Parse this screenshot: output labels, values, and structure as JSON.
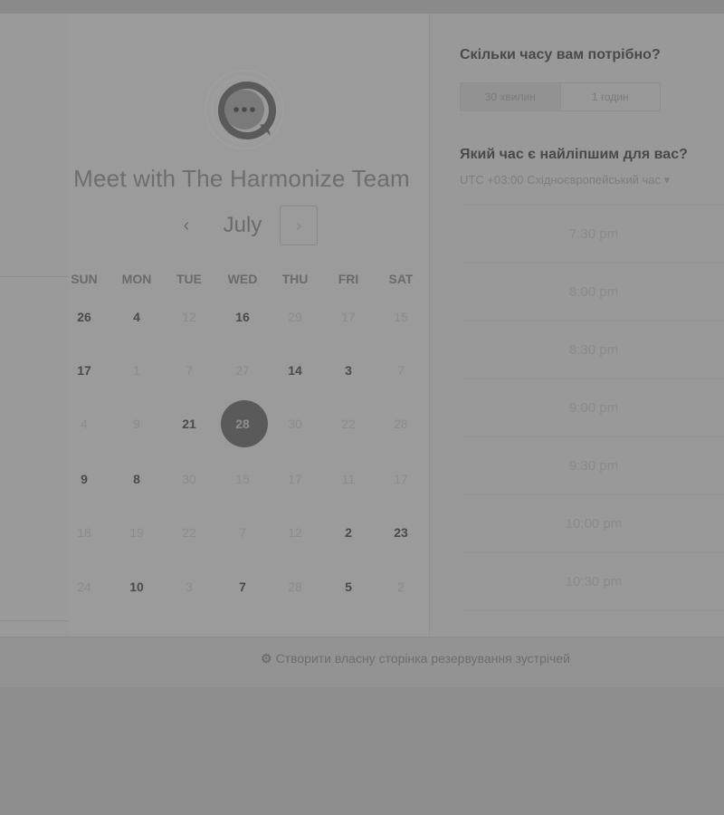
{
  "booking": {
    "title": "Meet with The Harmonize Team",
    "month": "July",
    "weekdays": [
      "SUN",
      "MON",
      "TUE",
      "WED",
      "THU",
      "FRI",
      "SAT"
    ],
    "weeks": [
      [
        "26",
        "4",
        "12",
        "16",
        "29",
        "17",
        "15"
      ],
      [
        "17",
        "1",
        "7",
        "27",
        "14",
        "3",
        "7"
      ],
      [
        "4",
        "9",
        "21",
        "28",
        "30",
        "22",
        "28"
      ],
      [
        "9",
        "8",
        "30",
        "15",
        "17",
        "11",
        "17"
      ],
      [
        "18",
        "19",
        "22",
        "7",
        "12",
        "2",
        "23"
      ],
      [
        "24",
        "10",
        "3",
        "7",
        "28",
        "5",
        "2"
      ]
    ],
    "selected_day": "28"
  },
  "duration": {
    "question": "Скільки часу вам потрібно?",
    "options": [
      "30 хвилин",
      "1 годин"
    ]
  },
  "time": {
    "question": "Який час є найліпшим для вас?",
    "timezone": "UTC +03:00 Східноєвропейський час ▾",
    "slots": [
      "7:30 pm",
      "8:00 pm",
      "8:30 pm",
      "9:00 pm",
      "9:30 pm",
      "10:00 pm",
      "10:30 pm"
    ]
  },
  "footer": {
    "icon": "hubspot-sprocket-icon",
    "link": "Створити власну сторінка резервування зустрічей"
  }
}
